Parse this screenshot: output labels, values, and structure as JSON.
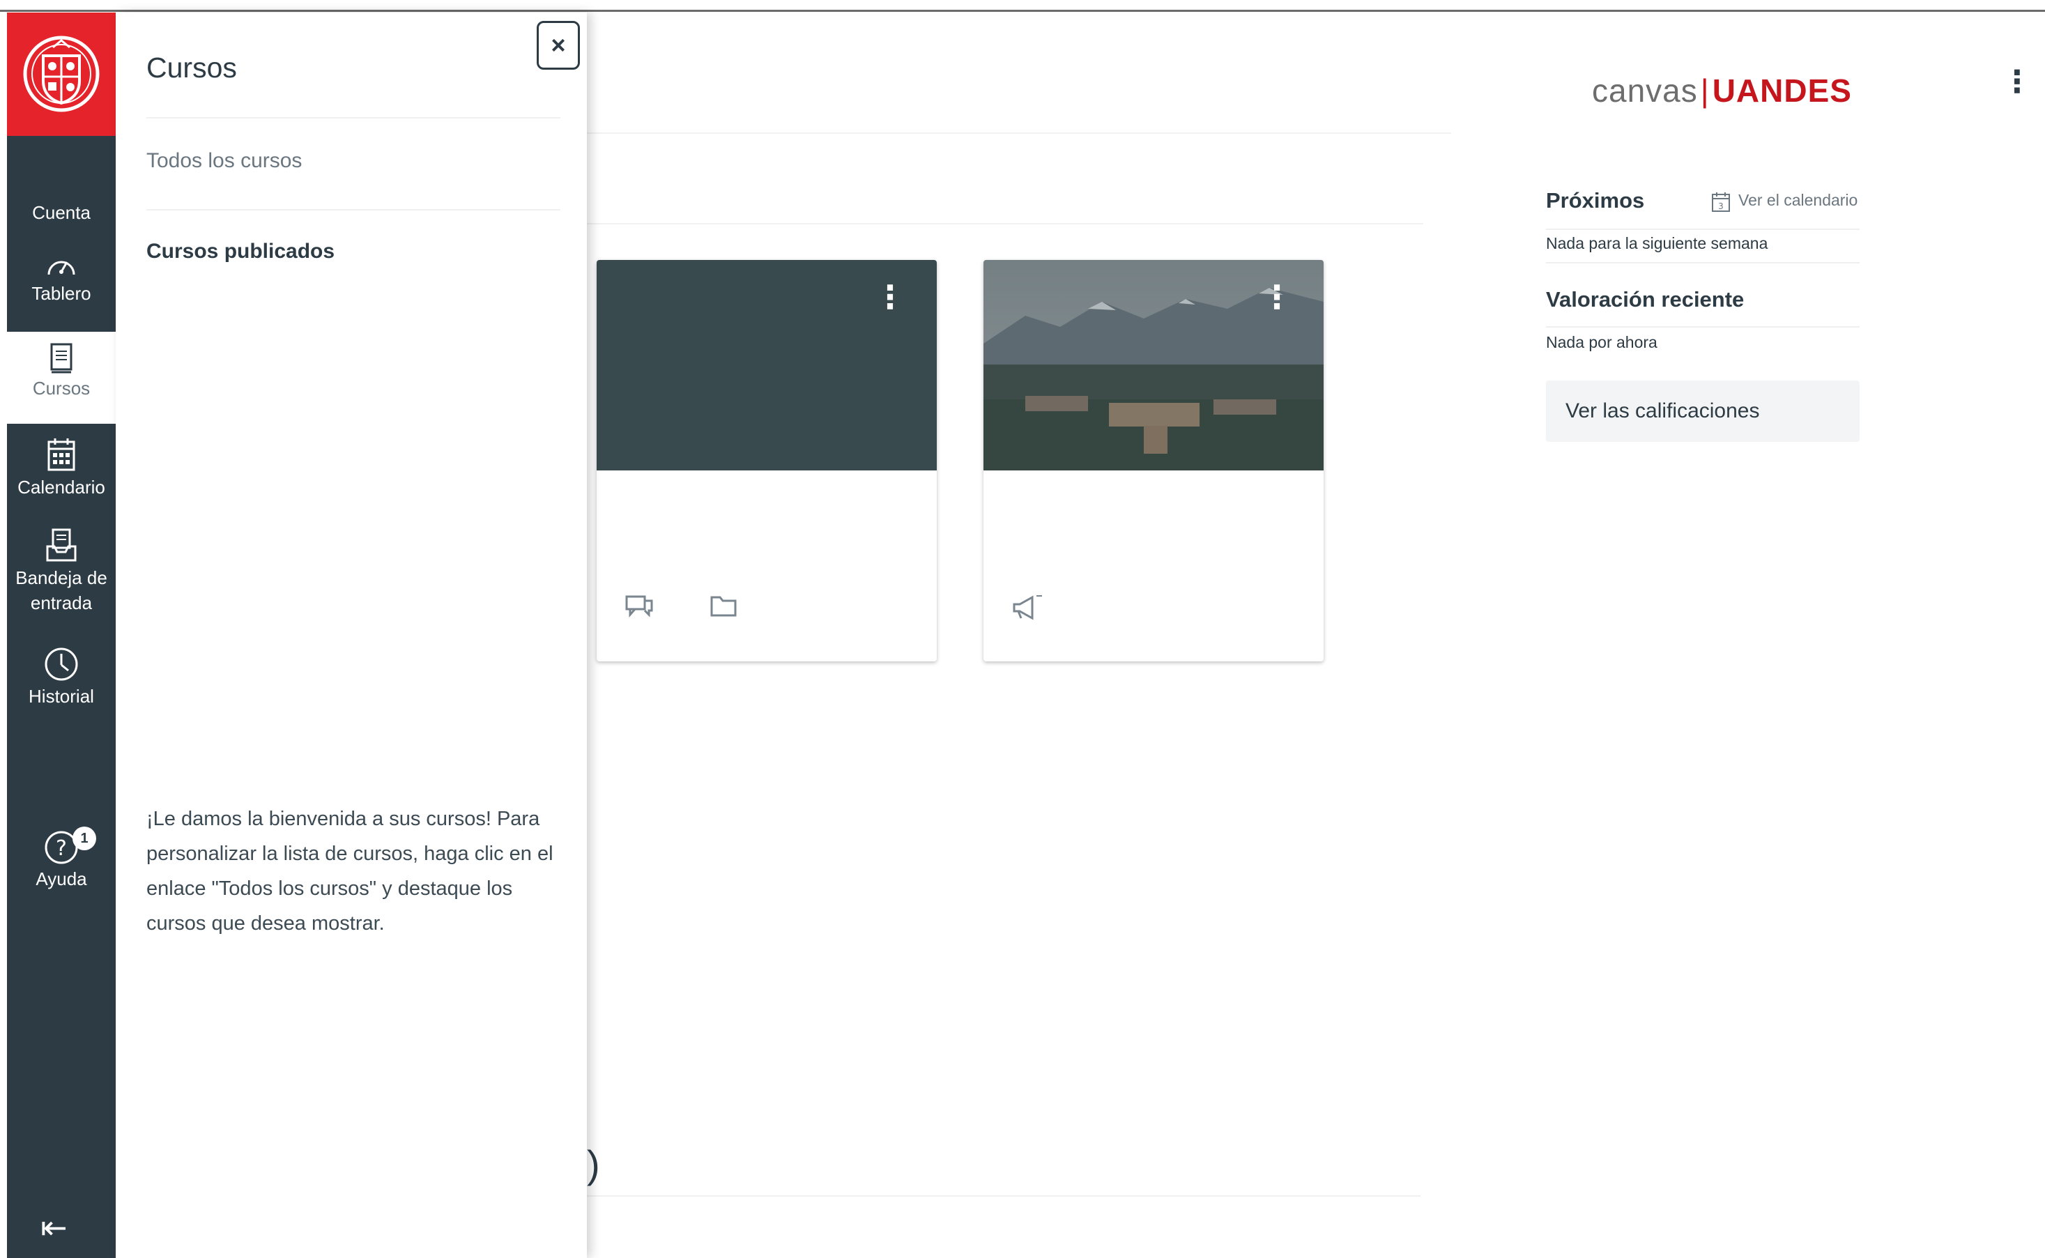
{
  "global_nav": {
    "items": [
      {
        "label": "Cuenta"
      },
      {
        "label": "Tablero"
      },
      {
        "label": "Cursos"
      },
      {
        "label": "Calendario"
      },
      {
        "label": "Bandeja de",
        "label2": "entrada"
      },
      {
        "label": "Historial"
      },
      {
        "label": "Ayuda",
        "badge": "1"
      }
    ],
    "active": "Cursos",
    "colors": {
      "nav_bg": "#2d3b45",
      "logo_bg": "#e4232b"
    }
  },
  "tray": {
    "title": "Cursos",
    "close_label": "×",
    "all_courses_link": "Todos los cursos",
    "section_title": "Cursos publicados",
    "welcome_text": "¡Le damos la bienvenida a sus cursos! Para personalizar la lista de cursos, haga clic en el enlace \"Todos los cursos\" y destaque los cursos que desea mostrar."
  },
  "main": {
    "kebab": "⋮",
    "partial_text": ")",
    "cards": [
      {
        "hero_color": "#384a4d",
        "icons": [
          "discussion-icon",
          "folder-icon"
        ]
      },
      {
        "hero_type": "campus-photo",
        "icons": [
          "announcement-icon"
        ]
      }
    ]
  },
  "right_sidebar": {
    "brand": {
      "left": "canvas",
      "separator": "|",
      "right": "UANDES"
    },
    "upcoming_title": "Próximos",
    "calendar_link": "Ver el calendario",
    "upcoming_empty": "Nada para la siguiente semana",
    "recent_title": "Valoración reciente",
    "recent_empty": "Nada por ahora",
    "grades_button": "Ver las calificaciones"
  }
}
